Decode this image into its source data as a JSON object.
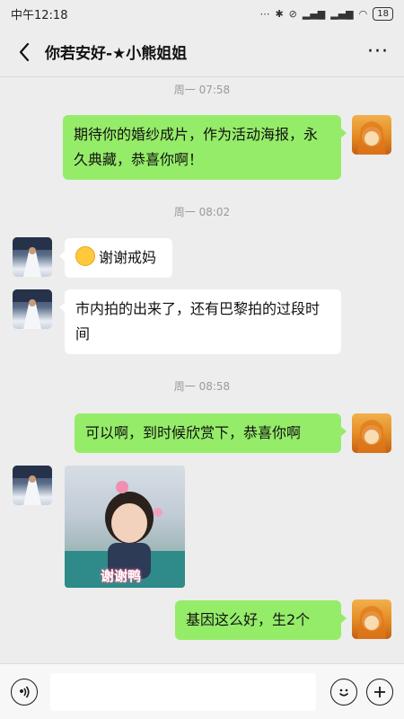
{
  "status_bar": {
    "time": "中午12:18",
    "battery": "18",
    "icons": [
      "dots-icon",
      "bluetooth-icon",
      "mute-icon",
      "hd-signal-icon",
      "signal-icon",
      "wifi-icon",
      "battery-icon"
    ]
  },
  "header": {
    "title": "你若安好-★小熊姐姐",
    "back_icon": "back-icon",
    "more_icon": "more-icon",
    "more_label": "···"
  },
  "messages": [
    {
      "type": "time",
      "text": "周一 07:58"
    },
    {
      "type": "text",
      "side": "right",
      "text": "期待你的婚纱成片，作为活动海报，永久典藏，恭喜你啊！"
    },
    {
      "type": "time",
      "text": "周一 08:02"
    },
    {
      "type": "text",
      "side": "left",
      "emoji": "grin-emoji",
      "text": "谢谢戒妈"
    },
    {
      "type": "text",
      "side": "left",
      "text": "市内拍的出来了，还有巴黎拍的过段时间"
    },
    {
      "type": "time",
      "text": "周一 08:58"
    },
    {
      "type": "text",
      "side": "right",
      "text": "可以啊，到时候欣赏下，恭喜你啊"
    },
    {
      "type": "image",
      "side": "left",
      "sticker_text": "谢谢鸭"
    },
    {
      "type": "text",
      "side": "right",
      "text": "基因这么好，生2个"
    }
  ],
  "input_bar": {
    "voice_icon": "voice-icon",
    "emoji_icon": "emoji-icon",
    "add_icon": "add-icon"
  },
  "colors": {
    "background": "#ededed",
    "sent_bubble": "#95ec69",
    "received_bubble": "#ffffff",
    "timestamp": "#9a9a9a"
  }
}
